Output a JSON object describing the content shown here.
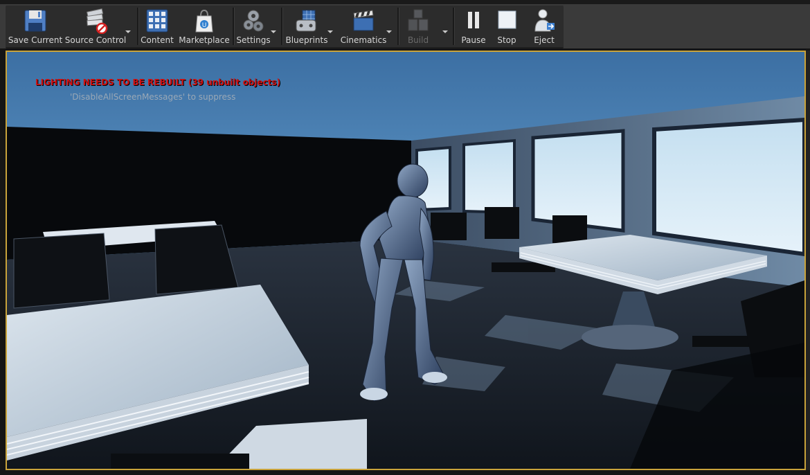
{
  "toolbar": {
    "items": [
      {
        "label": "Save Current",
        "icon": "save-icon"
      },
      {
        "label": "Source Control",
        "icon": "source-control-icon"
      },
      {
        "label": "Content",
        "icon": "content-icon"
      },
      {
        "label": "Marketplace",
        "icon": "marketplace-icon"
      },
      {
        "label": "Settings",
        "icon": "settings-icon"
      },
      {
        "label": "Blueprints",
        "icon": "blueprints-icon"
      },
      {
        "label": "Cinematics",
        "icon": "cinematics-icon"
      },
      {
        "label": "Build",
        "icon": "build-icon",
        "disabled": true
      },
      {
        "label": "Pause",
        "icon": "pause-icon"
      },
      {
        "label": "Stop",
        "icon": "stop-icon"
      },
      {
        "label": "Eject",
        "icon": "eject-icon"
      }
    ]
  },
  "viewport": {
    "warning": "LIGHTING NEEDS TO BE REBUILT (39 unbuilt objects)",
    "suppress_hint": "'DisableAllScreenMessages' to suppress"
  },
  "colors": {
    "accent_border": "#c9a33a",
    "warning_text": "#d01010"
  }
}
